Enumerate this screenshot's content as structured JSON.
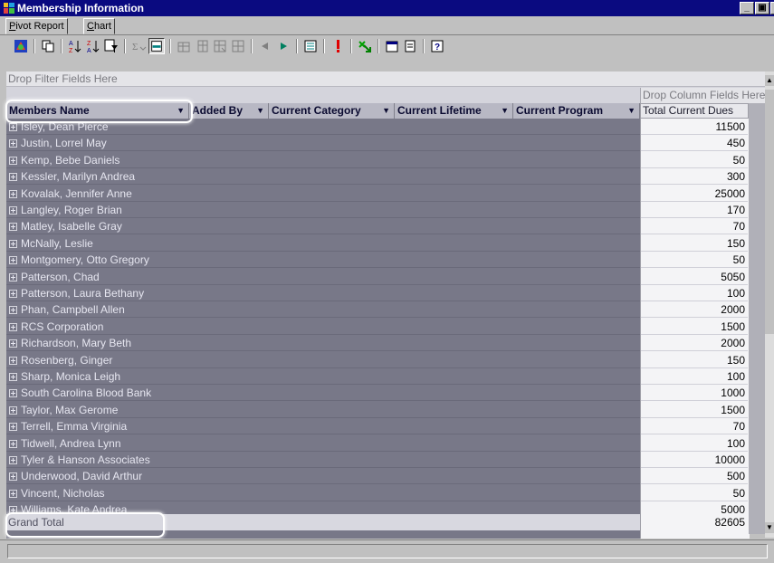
{
  "window": {
    "title": "Membership Information",
    "controls": [
      "_",
      "̅",
      "x"
    ]
  },
  "tabs": [
    {
      "label": "Pivot Report",
      "active": true
    },
    {
      "label": "Chart",
      "active": false
    }
  ],
  "toolbar": {
    "icons": [
      "office-logo-icon",
      "copy-icon",
      "sort-ascending-icon",
      "sort-descending-icon",
      "filter-icon",
      "autosum-icon",
      "subtotal-icon",
      "move-to-row-icon",
      "move-to-column-icon",
      "show-detail-icon",
      "hide-detail-icon",
      "collapse-icon",
      "expand-icon",
      "field-list-icon",
      "refresh-icon",
      "export-icon",
      "commands-icon",
      "properties-icon",
      "help-icon"
    ]
  },
  "pivot": {
    "filter_drop_text": "Drop Filter Fields Here",
    "column_drop_text": "Drop Column Fields Here",
    "row_fields": [
      "Members Name",
      "Added By",
      "Current Category",
      "Current Lifetime",
      "Current Program"
    ],
    "data_field": "Total Current Dues",
    "rows": [
      {
        "name": "Isley, Dean Pierce",
        "value": "11500"
      },
      {
        "name": "Justin, Lorrel May",
        "value": "450"
      },
      {
        "name": "Kemp, Bebe Daniels",
        "value": "50"
      },
      {
        "name": "Kessler, Marilyn Andrea",
        "value": "300"
      },
      {
        "name": "Kovalak, Jennifer Anne",
        "value": "25000"
      },
      {
        "name": "Langley, Roger Brian",
        "value": "170"
      },
      {
        "name": "Matley, Isabelle Gray",
        "value": "70"
      },
      {
        "name": "McNally, Leslie",
        "value": "150"
      },
      {
        "name": "Montgomery, Otto Gregory",
        "value": "50"
      },
      {
        "name": "Patterson, Chad",
        "value": "5050"
      },
      {
        "name": "Patterson, Laura Bethany",
        "value": "100"
      },
      {
        "name": "Phan, Campbell Allen",
        "value": "2000"
      },
      {
        "name": "RCS Corporation",
        "value": "1500"
      },
      {
        "name": "Richardson, Mary Beth",
        "value": "2000"
      },
      {
        "name": "Rosenberg, Ginger",
        "value": "150"
      },
      {
        "name": "Sharp, Monica Leigh",
        "value": "100"
      },
      {
        "name": "South Carolina Blood Bank",
        "value": "1000"
      },
      {
        "name": "Taylor, Max Gerome",
        "value": "1500"
      },
      {
        "name": "Terrell, Emma Virginia",
        "value": "70"
      },
      {
        "name": "Tidwell, Andrea Lynn",
        "value": "100"
      },
      {
        "name": "Tyler & Hanson Associates",
        "value": "10000"
      },
      {
        "name": "Underwood, David Arthur",
        "value": "500"
      },
      {
        "name": "Vincent, Nicholas",
        "value": "50"
      },
      {
        "name": "Williams, Kate Andrea",
        "value": "5000"
      }
    ],
    "grand_total_label": "Grand Total",
    "grand_total_value": "82605"
  }
}
